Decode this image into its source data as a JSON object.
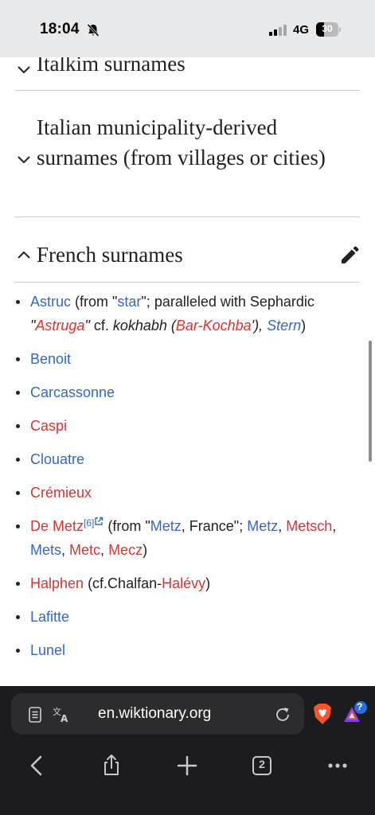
{
  "status_bar": {
    "time": "18:04",
    "network": "4G",
    "battery": "30"
  },
  "sections": {
    "italkim": {
      "title": "Italkim surnames",
      "expanded": false
    },
    "italian": {
      "title": "Italian municipality-derived surnames (from villages or cities)",
      "expanded": false
    },
    "french": {
      "title": "French surnames",
      "expanded": true
    }
  },
  "entries": {
    "astruc": {
      "name": "Astruc",
      "t1": " (from \"",
      "star": "star",
      "t2": "\"; paralleled with Sephardic ",
      "q1": "\"",
      "astruga": "Astruga",
      "q2": "\"",
      "t3": " cf. ",
      "kokhabh": "kokhabh",
      "t4": " (",
      "barkochba": "Bar-Kochba",
      "t5": "'), ",
      "stern": "Stern",
      "t6": ")"
    },
    "benoit": {
      "name": "Benoit"
    },
    "carcassonne": {
      "name": "Carcassonne"
    },
    "caspi": {
      "name": "Caspi"
    },
    "clouatre": {
      "name": "Clouatre"
    },
    "cremieux": {
      "name": "Crémieux"
    },
    "demetz": {
      "name": "De Metz",
      "ref": "[6]",
      "t1": " (from \"",
      "metz1": "Metz",
      "t2": ", France\"; ",
      "metz2": "Metz",
      "c1": ", ",
      "metsch": "Metsch",
      "c2": ", ",
      "mets": "Mets",
      "c3": ", ",
      "metc": "Metc",
      "c4": ", ",
      "mecz": "Mecz",
      "t3": ")"
    },
    "halphen": {
      "name": "Halphen",
      "t1": " (cf.Chalfan-",
      "halevy": "Halévy",
      "t2": ")"
    },
    "lafitte": {
      "name": "Lafitte"
    },
    "lunel": {
      "name": "Lunel"
    }
  },
  "browser": {
    "url": "en.wiktionary.org",
    "tab_count": "2",
    "rewards_badge": "?"
  },
  "colors": {
    "link_blue": "#3366cc",
    "link_red": "#d73333",
    "status_bg": "#e8e9eb",
    "browser_bg": "#1c1c1e",
    "brave_orange": "#fb542b"
  },
  "icons": [
    "bell-slash-icon",
    "signal-icon",
    "battery-icon",
    "chevron-down-icon",
    "chevron-up-icon",
    "pencil-icon",
    "external-link-icon",
    "reader-mode-icon",
    "translate-icon",
    "reload-icon",
    "brave-shield-icon",
    "rewards-icon",
    "back-icon",
    "share-icon",
    "plus-icon",
    "tabs-icon",
    "more-icon"
  ]
}
